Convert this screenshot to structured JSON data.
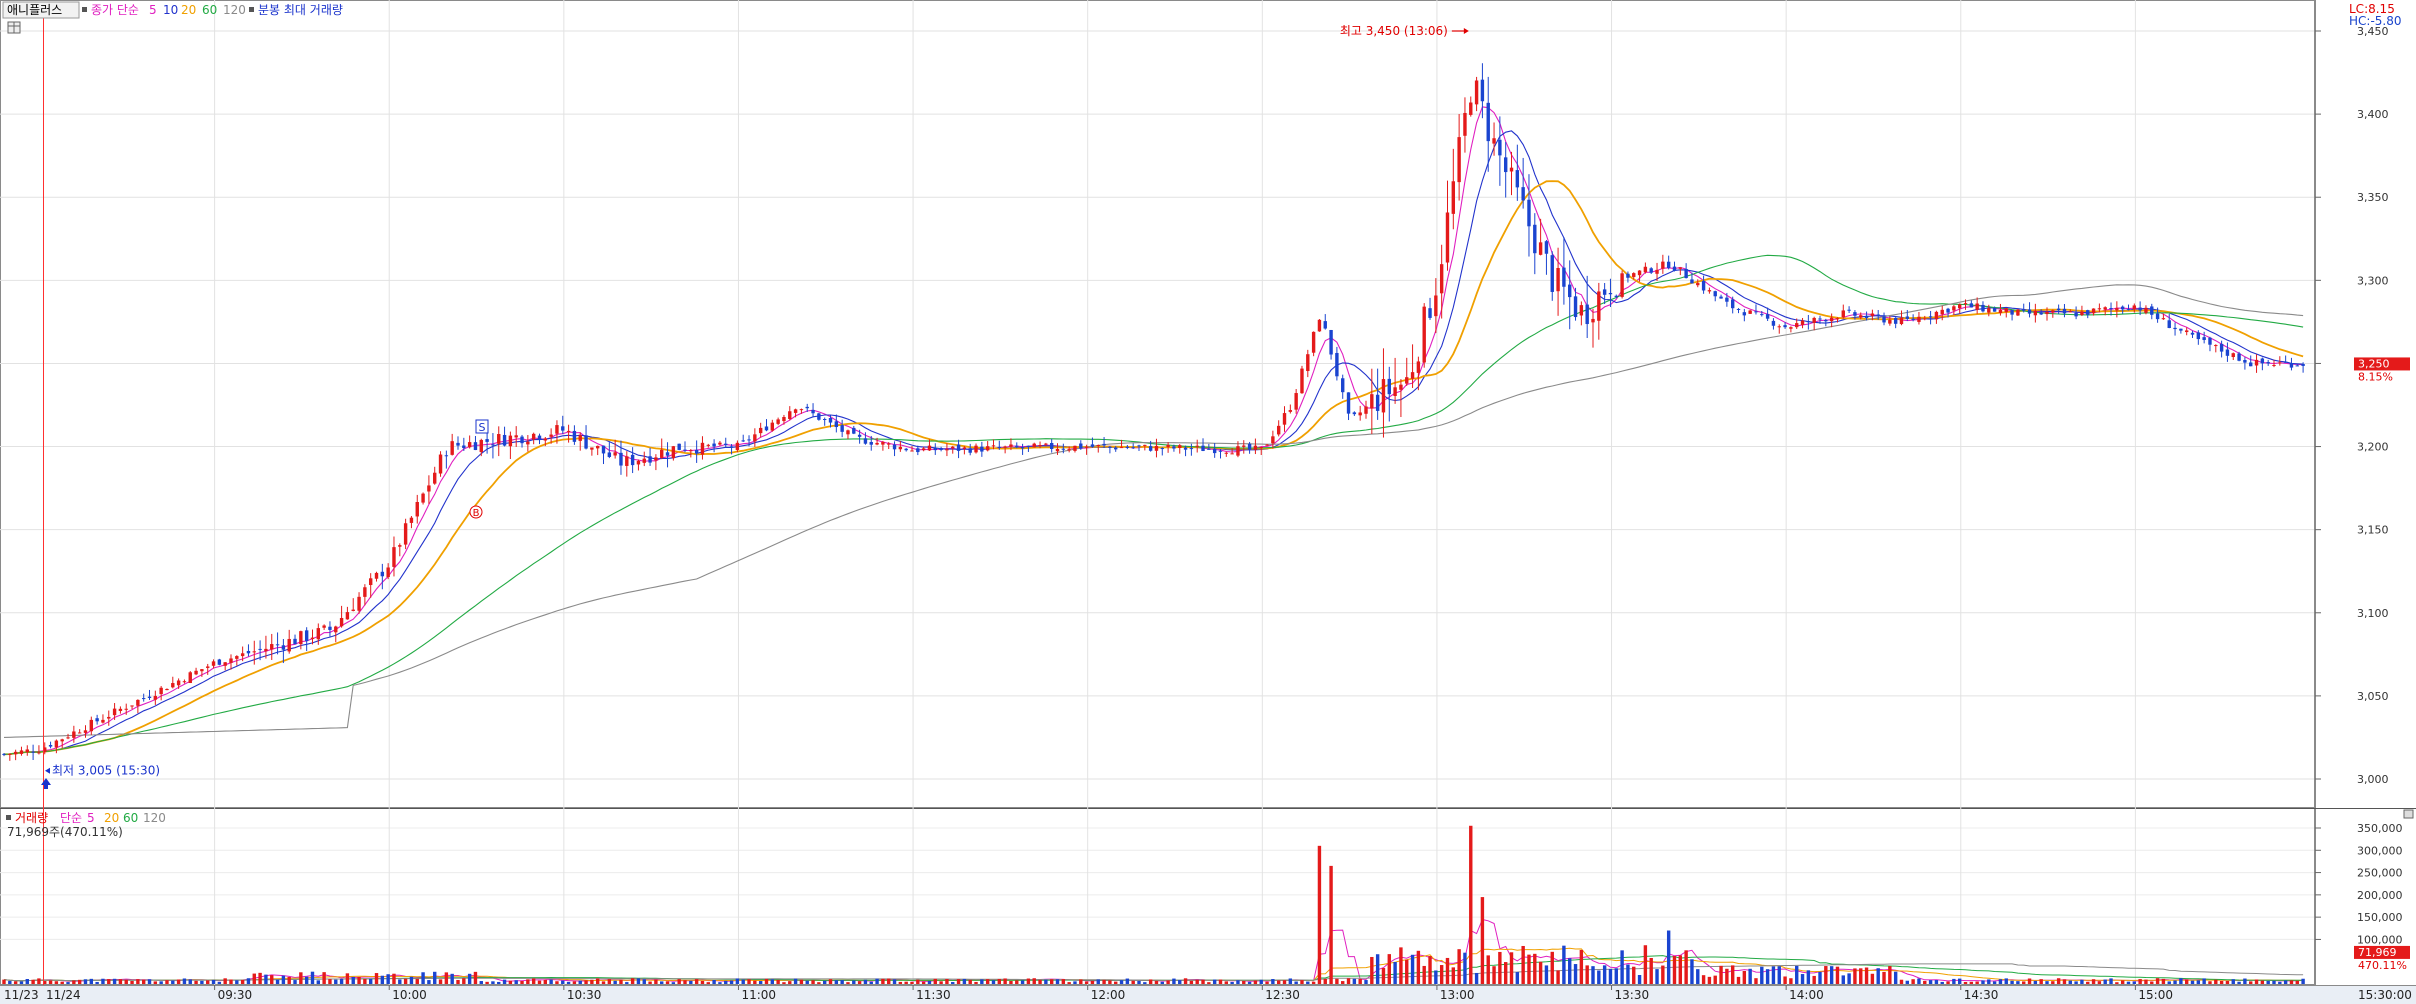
{
  "chart_data": [
    {
      "type": "candlestick",
      "title": "",
      "header": {
        "name": "애니플러스",
        "legend_prefix": "종가 단순",
        "ma_periods": [
          "5",
          "10",
          "20",
          "60",
          "120"
        ],
        "extra": "분봉 최대 거래량"
      },
      "ylim": [
        2980,
        3470
      ],
      "y_ticks": [
        "3,000",
        "3,050",
        "3,100",
        "3,150",
        "3,200",
        "3,250",
        "3,300",
        "3,350",
        "3,400",
        "3,450"
      ],
      "x_tick_labels": [
        "11/23",
        "11/24",
        "09:30",
        "10:00",
        "10:30",
        "11:00",
        "11:30",
        "12:00",
        "12:30",
        "13:00",
        "13:30",
        "14:00",
        "14:30",
        "15:00",
        "15:30:00"
      ],
      "top_right": {
        "lc": "LC:8.15",
        "hc": "HC:-5.80"
      },
      "current_price": {
        "value": 3250,
        "label": "3,250",
        "change": "8.15%"
      },
      "annotations": {
        "high": {
          "value": 3450,
          "label": "최고 3,450 (13:06)"
        },
        "low": {
          "value": 3005,
          "label": "최저 3,005 (15:30)"
        }
      },
      "markers": [
        "S",
        "B"
      ],
      "close_points": [
        [
          "11/23",
          3014
        ],
        [
          "11/24",
          3018
        ],
        [
          "09:30",
          3070
        ],
        [
          "09:50",
          3090
        ],
        [
          "10:00",
          3130
        ],
        [
          "10:10",
          3200
        ],
        [
          "10:20",
          3205
        ],
        [
          "10:30",
          3210
        ],
        [
          "10:40",
          3190
        ],
        [
          "10:50",
          3200
        ],
        [
          "11:00",
          3200
        ],
        [
          "11:10",
          3225
        ],
        [
          "11:20",
          3205
        ],
        [
          "11:30",
          3198
        ],
        [
          "12:00",
          3200
        ],
        [
          "12:30",
          3198
        ],
        [
          "12:35",
          3225
        ],
        [
          "12:40",
          3280
        ],
        [
          "12:45",
          3215
        ],
        [
          "12:50",
          3230
        ],
        [
          "12:55",
          3240
        ],
        [
          "13:00",
          3300
        ],
        [
          "13:06",
          3420
        ],
        [
          "13:10",
          3380
        ],
        [
          "13:15",
          3340
        ],
        [
          "13:20",
          3300
        ],
        [
          "13:25",
          3280
        ],
        [
          "13:30",
          3300
        ],
        [
          "13:40",
          3310
        ],
        [
          "13:50",
          3285
        ],
        [
          "14:00",
          3272
        ],
        [
          "14:10",
          3280
        ],
        [
          "14:20",
          3275
        ],
        [
          "14:30",
          3285
        ],
        [
          "14:40",
          3280
        ],
        [
          "14:50",
          3280
        ],
        [
          "15:00",
          3285
        ],
        [
          "15:10",
          3265
        ],
        [
          "15:20",
          3250
        ]
      ],
      "ma_series": [
        {
          "name": "5",
          "color": "#e020c0"
        },
        {
          "name": "10",
          "color": "#2233cc"
        },
        {
          "name": "20",
          "color": "#f0a000"
        },
        {
          "name": "60",
          "color": "#22aa44"
        },
        {
          "name": "120",
          "color": "#8a8a8a"
        }
      ]
    },
    {
      "type": "bar",
      "title": "",
      "header": {
        "label": "거래량",
        "legend_prefix": "단순",
        "ma_periods": [
          "5",
          "20",
          "60",
          "120"
        ]
      },
      "info": "71,969주(470.11%)",
      "ylim": [
        0,
        380000
      ],
      "y_ticks": [
        "100,000",
        "150,000",
        "200,000",
        "250,000",
        "300,000",
        "350,000"
      ],
      "current": {
        "label": "71,969",
        "pct": "470.11%"
      },
      "notable_volumes": [
        [
          "12:40",
          310000
        ],
        [
          "12:42",
          265000
        ],
        [
          "13:06",
          355000
        ],
        [
          "13:08",
          195000
        ],
        [
          "13:40",
          120000
        ]
      ]
    }
  ]
}
